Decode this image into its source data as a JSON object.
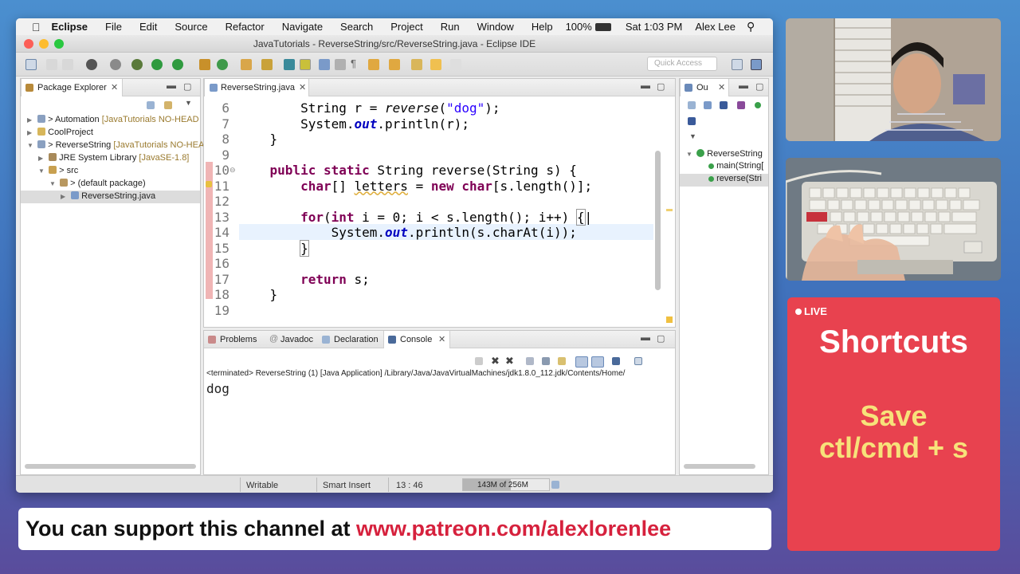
{
  "menubar": {
    "app": "Eclipse",
    "items": [
      "File",
      "Edit",
      "Source",
      "Refactor",
      "Navigate",
      "Search",
      "Project",
      "Run",
      "Window",
      "Help"
    ],
    "battery": "100%",
    "clock": "Sat 1:03 PM",
    "user": "Alex Lee"
  },
  "window": {
    "title": "JavaTutorials - ReverseString/src/ReverseString.java - Eclipse IDE",
    "quick_access_placeholder": "Quick Access"
  },
  "package_explorer": {
    "tab_label": "Package Explorer",
    "tree": [
      {
        "label": "> Automation",
        "decoration": "[JavaTutorials NO-HEAD"
      },
      {
        "label": "CoolProject",
        "decoration": ""
      },
      {
        "label": "> ReverseString",
        "decoration": "[JavaTutorials NO-HEA"
      },
      {
        "label": "JRE System Library",
        "decoration": "[JavaSE-1.8]"
      },
      {
        "label": "> src",
        "decoration": ""
      },
      {
        "label": "> (default package)",
        "decoration": ""
      },
      {
        "label": "ReverseString.java",
        "decoration": ""
      }
    ]
  },
  "editor": {
    "tab_label": "ReverseString.java",
    "line_numbers": [
      "6",
      "7",
      "8",
      "9",
      "10",
      "11",
      "12",
      "13",
      "14",
      "15",
      "16",
      "17",
      "18",
      "19"
    ]
  },
  "outline": {
    "tab_label": "Ou",
    "class_name": "ReverseString",
    "methods": [
      "main(String[",
      "reverse(Stri"
    ]
  },
  "bottom_tabs": {
    "problems": "Problems",
    "javadoc": "Javadoc",
    "declaration": "Declaration",
    "console": "Console"
  },
  "console": {
    "header": "<terminated> ReverseString (1) [Java Application] /Library/Java/JavaVirtualMachines/jdk1.8.0_112.jdk/Contents/Home/",
    "output": "dog"
  },
  "status": {
    "writable": "Writable",
    "insert_mode": "Smart Insert",
    "position": "13 : 46",
    "memory": "143M of 256M",
    "memory_used_fraction": 0.56
  },
  "overlay": {
    "live_label": "LIVE",
    "title": "Shortcuts",
    "action": "Save",
    "keys": "ctl/cmd + s"
  },
  "banner": {
    "text": "You can support this channel at ",
    "link": "www.patreon.com/alexlorenlee"
  },
  "colors": {
    "card": "#e8424f",
    "shortcut_yellow": "#f7e27a",
    "link_red": "#d6213d"
  }
}
